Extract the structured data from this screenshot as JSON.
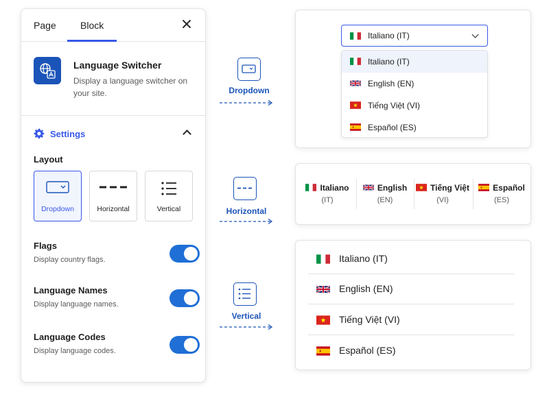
{
  "sidebar": {
    "tabs": [
      "Page",
      "Block"
    ],
    "block": {
      "title": "Language Switcher",
      "description": "Display a language switcher on your site."
    },
    "settings_title": "Settings",
    "layout_label": "Layout",
    "layout_options": [
      "Dropdown",
      "Horizontal",
      "Vertical"
    ],
    "selected_layout": "Dropdown",
    "toggles": [
      {
        "title": "Flags",
        "description": "Display country flags.",
        "on": true
      },
      {
        "title": "Language Names",
        "description": "Display language names.",
        "on": true
      },
      {
        "title": "Language Codes",
        "description": "Display language codes.",
        "on": true
      }
    ]
  },
  "previews": {
    "dropdown_label": "Dropdown",
    "horizontal_label": "Horizontal",
    "vertical_label": "Vertical"
  },
  "dropdown": {
    "selected": "Italiano (IT)",
    "options": [
      "Italiano (IT)",
      "English (EN)",
      "Tiếng Việt (VI)",
      "Español (ES)"
    ]
  },
  "horizontal": {
    "items": [
      {
        "name": "Italiano",
        "code": "(IT)"
      },
      {
        "name": "English",
        "code": "(EN)"
      },
      {
        "name": "Tiếng Việt",
        "code": "(VI)"
      },
      {
        "name": "Español",
        "code": "(ES)"
      }
    ]
  },
  "vertical": {
    "items": [
      "Italiano (IT)",
      "English (EN)",
      "Tiếng Việt (VI)",
      "Español (ES)"
    ]
  },
  "colors": {
    "accent": "#3858e9",
    "brand_blue": "#1b54b8",
    "toggle_on": "#1f6fd6"
  },
  "icons": [
    "close-icon",
    "translate-icon",
    "gear-icon",
    "chevron-up-icon",
    "chevron-down-icon",
    "dropdown-layout-icon",
    "horizontal-layout-icon",
    "vertical-layout-icon",
    "flag-it-icon",
    "flag-gb-icon",
    "flag-vn-icon",
    "flag-es-icon"
  ]
}
